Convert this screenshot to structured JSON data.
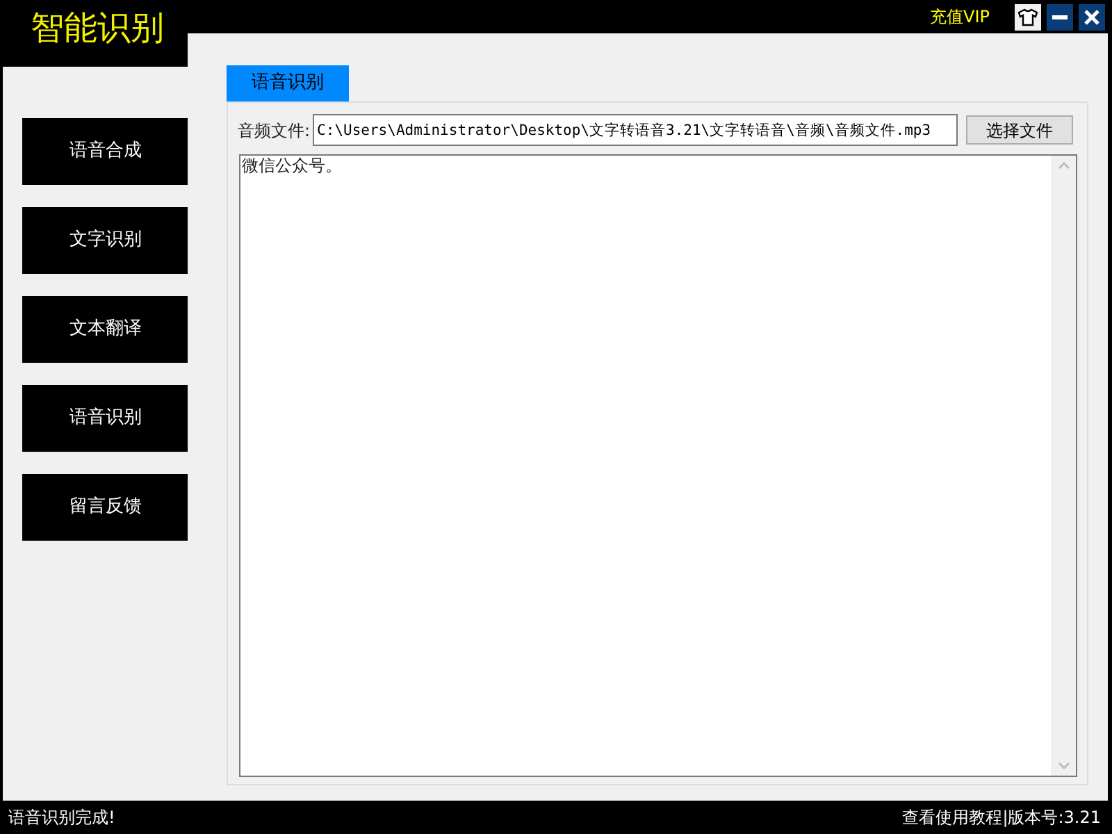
{
  "app": {
    "title": "智能识别",
    "vip_link": "充值VIP"
  },
  "sidebar": {
    "items": [
      {
        "label": "语音合成"
      },
      {
        "label": "文字识别"
      },
      {
        "label": "文本翻译"
      },
      {
        "label": "语音识别"
      },
      {
        "label": "留言反馈"
      }
    ]
  },
  "tabs": [
    {
      "label": "语音识别",
      "selected": true
    }
  ],
  "file_row": {
    "label": "音频文件:",
    "value": "C:\\Users\\Administrator\\Desktop\\文字转语音3.21\\文字转语音\\音频\\音频文件.mp3",
    "button": "选择文件"
  },
  "result": {
    "value": "微信公众号。"
  },
  "status_bar": {
    "message": "语音识别完成!",
    "help_link": "查看使用教程",
    "version": "|版本号:3.21"
  }
}
